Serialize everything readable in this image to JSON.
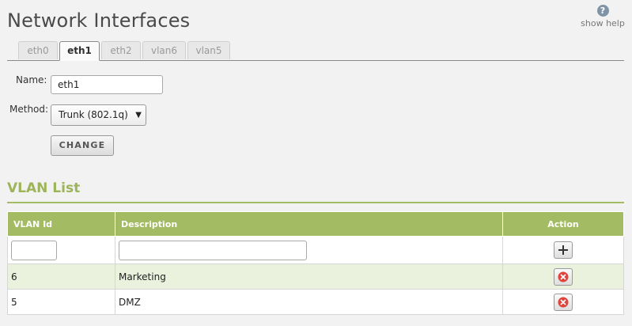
{
  "header": {
    "title": "Network Interfaces",
    "help_label": "show help",
    "help_icon": "question-icon"
  },
  "tabs": [
    {
      "label": "eth0",
      "active": false
    },
    {
      "label": "eth1",
      "active": true
    },
    {
      "label": "eth2",
      "active": false
    },
    {
      "label": "vlan6",
      "active": false
    },
    {
      "label": "vlan5",
      "active": false
    }
  ],
  "form": {
    "name_label": "Name:",
    "name_value": "eth1",
    "method_label": "Method:",
    "method_value": "Trunk (802.1q)",
    "change_label": "CHANGE"
  },
  "vlan_list": {
    "title": "VLAN List",
    "columns": [
      "VLAN Id",
      "Description",
      "Action"
    ],
    "new_row": {
      "vlan_id": "",
      "description": "",
      "action_icon": "plus-icon"
    },
    "rows": [
      {
        "vlan_id": "6",
        "description": "Marketing",
        "action_icon": "delete-icon"
      },
      {
        "vlan_id": "5",
        "description": "DMZ",
        "action_icon": "delete-icon"
      }
    ]
  },
  "colors": {
    "accent": "#a3bb62",
    "section_title": "#9cb45a",
    "alt_row": "#eaf1dc",
    "delete_red": "#e0433a"
  }
}
